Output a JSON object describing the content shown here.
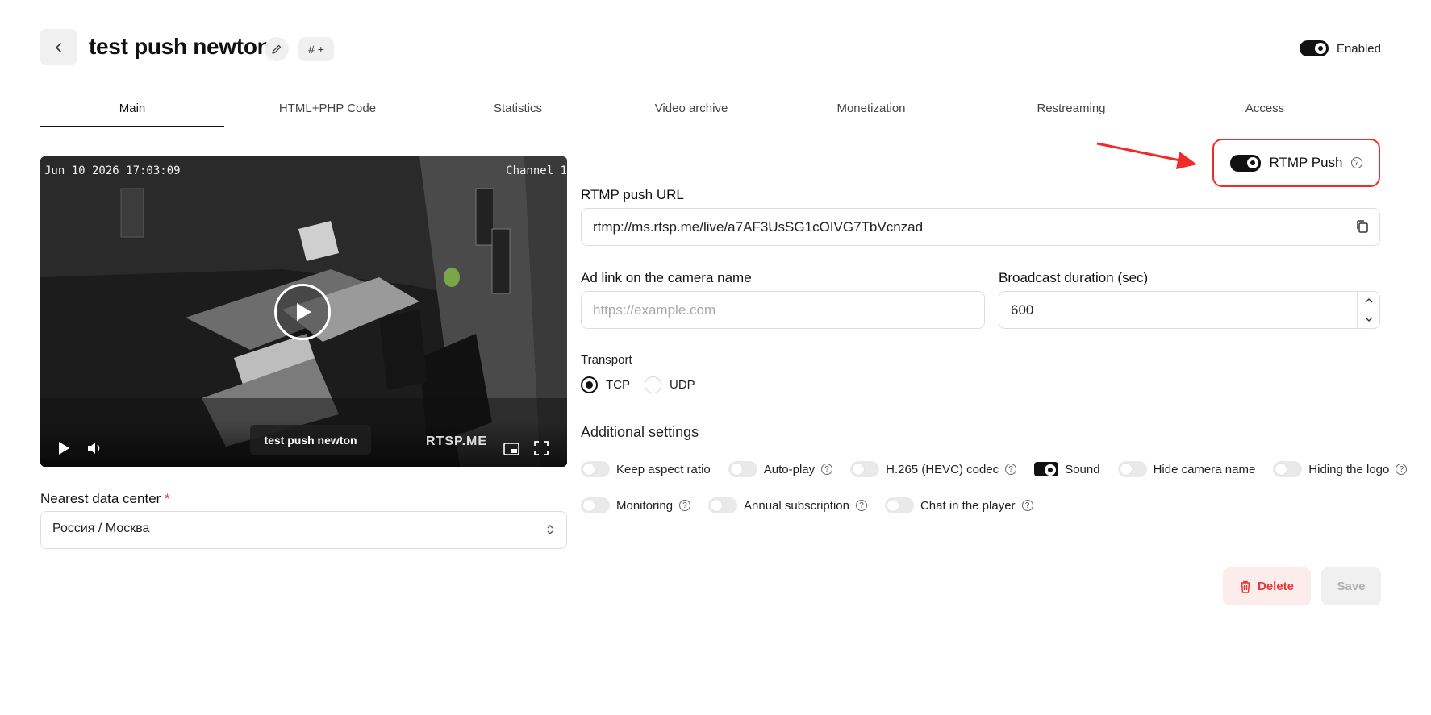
{
  "header": {
    "title": "test push newton",
    "tag_label": "# +",
    "enabled_label": "Enabled",
    "enabled": true
  },
  "tabs": [
    {
      "label": "Main",
      "active": true
    },
    {
      "label": "HTML+PHP Code"
    },
    {
      "label": "Statistics"
    },
    {
      "label": "Video archive"
    },
    {
      "label": "Monetization"
    },
    {
      "label": "Restreaming"
    },
    {
      "label": "Access"
    }
  ],
  "video": {
    "timestamp": "Jun 10 2026 17:03:09",
    "channel": "Channel 1",
    "camera_name": "test push newton",
    "brand": "RTSP.ME"
  },
  "data_center": {
    "label": "Nearest data center",
    "required_mark": "*",
    "value": "Россия / Москва"
  },
  "rtmp_push": {
    "label": "RTMP Push",
    "enabled": true,
    "highlight_color": "#ef2b2b"
  },
  "rtmp_url": {
    "label": "RTMP push URL",
    "value": "rtmp://ms.rtsp.me/live/a7AF3UsSG1cOIVG7TbVcnzad"
  },
  "ad_link": {
    "label": "Ad link on the camera name",
    "placeholder": "https://example.com"
  },
  "broadcast": {
    "label": "Broadcast duration (sec)",
    "value": "600"
  },
  "transport": {
    "label": "Transport",
    "options": [
      "TCP",
      "UDP"
    ],
    "selected": "TCP"
  },
  "additional": {
    "title": "Additional settings",
    "row1": [
      {
        "label": "Keep aspect ratio",
        "on": false,
        "help": false
      },
      {
        "label": "Auto-play",
        "on": false,
        "help": true
      },
      {
        "label": "H.265 (HEVC) codec",
        "on": false,
        "help": true
      },
      {
        "label": "Sound",
        "on": true,
        "help": false
      },
      {
        "label": "Hide camera name",
        "on": false,
        "help": false
      },
      {
        "label": "Hiding the logo",
        "on": false,
        "help": true
      }
    ],
    "row2": [
      {
        "label": "Monitoring",
        "on": false,
        "help": true
      },
      {
        "label": "Annual subscription",
        "on": false,
        "help": true
      },
      {
        "label": "Chat in the player",
        "on": false,
        "help": true
      }
    ]
  },
  "actions": {
    "delete_label": "Delete",
    "save_label": "Save"
  }
}
